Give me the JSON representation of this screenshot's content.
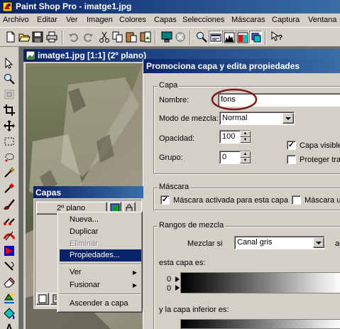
{
  "app": {
    "title": "Paint Shop Pro - imatge1.jpg"
  },
  "menu": [
    "Archivo",
    "Editar",
    "Ver",
    "Imagen",
    "Colores",
    "Capas",
    "Selecciones",
    "Máscaras",
    "Captura",
    "Ventana"
  ],
  "image_window": {
    "title": "imatge1.jpg [1:1] (2º plano)"
  },
  "dialog": {
    "title": "Promociona capa y edita propiedades",
    "capa": {
      "group_label": "Capa",
      "nombre_label": "Nombre:",
      "nombre_value": "fons",
      "modo_label": "Modo de mezcla:",
      "modo_value": "Normal",
      "opacidad_label": "Opacidad:",
      "opacidad_value": "100",
      "grupo_label": "Grupo:",
      "grupo_value": "0",
      "visible_label": "Capa visible",
      "visible_checked": true,
      "proteger_label": "Proteger tran",
      "proteger_checked": false
    },
    "mascara": {
      "group_label": "Máscara",
      "activada_label": "Máscara activada para esta capa",
      "activada_checked": true,
      "mascara_u_label": "Máscara u",
      "mascara_u_checked": false
    },
    "rangos": {
      "group_label": "Rangos de mezcla",
      "mezclar_label": "Mezclar si",
      "mezclar_value": "Canal gris",
      "extra_label": "ac",
      "esta_capa_label": "esta capa es:",
      "esta_min": "0",
      "esta_max": "0",
      "inferior_label": "y la capa inferior es:"
    }
  },
  "layers_palette": {
    "title": "Capas",
    "layer_name": "2º plano"
  },
  "context_menu": {
    "items": [
      {
        "label": "Nueva...",
        "state": "normal"
      },
      {
        "label": "Duplicar",
        "state": "normal"
      },
      {
        "label": "Eliminar",
        "state": "disabled"
      },
      {
        "label": "Propiedades...",
        "state": "selected"
      },
      {
        "label": "Ver",
        "state": "submenu"
      },
      {
        "label": "Fusionar",
        "state": "submenu"
      },
      {
        "label": "Ascender a capa",
        "state": "normal"
      }
    ]
  },
  "colors": {
    "titlebar": "#0a246a",
    "face": "#d4d0c8",
    "highlight_circle": "#7a1a1a"
  }
}
